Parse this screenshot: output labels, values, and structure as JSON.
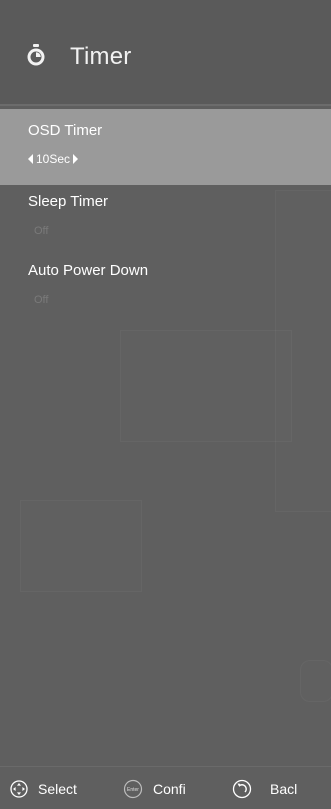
{
  "header": {
    "title": "Timer",
    "icon": "stopwatch-icon"
  },
  "menu": {
    "items": [
      {
        "label": "OSD Timer",
        "value": "10Sec",
        "selected": true
      },
      {
        "label": "Sleep Timer",
        "value": "Off",
        "selected": false
      },
      {
        "label": "Auto Power Down",
        "value": "Off",
        "selected": false
      }
    ]
  },
  "footer": {
    "select_label": "Select",
    "enter_icon_text": "Enter",
    "confirm_label": "Confi",
    "back_label": "Bacl"
  },
  "colors": {
    "background": "#5f5f5f",
    "selected_row": "#9a9a9a",
    "text": "#ffffff",
    "muted_value": "#7a7a7a"
  }
}
